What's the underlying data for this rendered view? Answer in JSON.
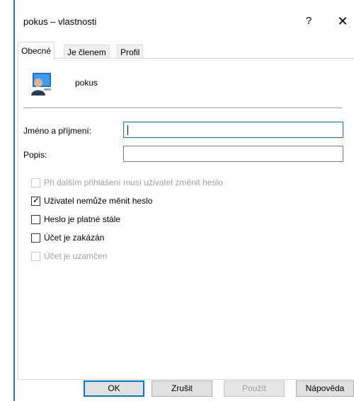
{
  "window": {
    "title": "pokus – vlastnosti",
    "help_label": "?",
    "close_label": "✕",
    "accent": "#2b73d6"
  },
  "tabs": [
    {
      "label": "Obecné",
      "active": true
    },
    {
      "label": "Je členem",
      "active": false
    },
    {
      "label": "Profil",
      "active": false
    }
  ],
  "user": {
    "icon": "user-computer-icon",
    "name": "pokus"
  },
  "fields": {
    "full_name": {
      "label": "Jméno a příjmení:",
      "value": ""
    },
    "description": {
      "label": "Popis:",
      "value": ""
    }
  },
  "checkboxes": [
    {
      "label": "Při dalším přihlášení musí uživatel změnit heslo",
      "checked": false,
      "enabled": false
    },
    {
      "label": "Uživatel nemůže měnit heslo",
      "checked": true,
      "enabled": true
    },
    {
      "label": "Heslo je platné stále",
      "checked": false,
      "enabled": true
    },
    {
      "label": "Účet je zakázán",
      "checked": false,
      "enabled": true
    },
    {
      "label": "Účet je uzamčen",
      "checked": false,
      "enabled": false
    }
  ],
  "buttons": {
    "ok": "OK",
    "cancel": "Zrušit",
    "apply": "Použít",
    "help": "Nápověda"
  }
}
